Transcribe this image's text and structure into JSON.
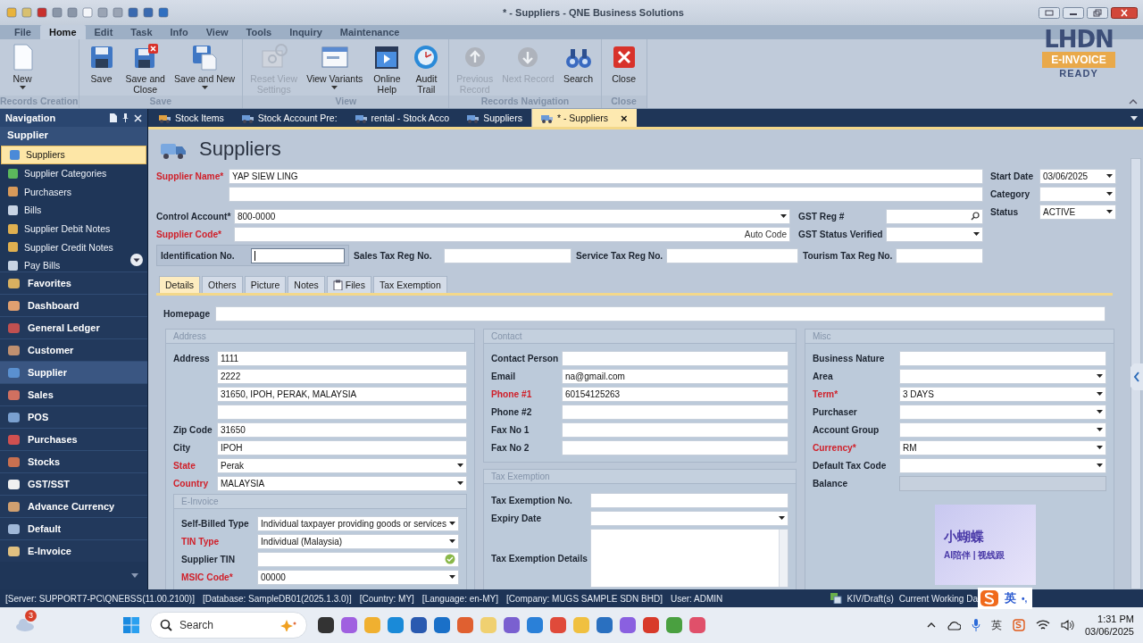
{
  "window": {
    "title": "* - Suppliers - QNE Business Solutions"
  },
  "ribbon": {
    "tabs": [
      {
        "label": "File",
        "selected": false
      },
      {
        "label": "Home",
        "selected": true
      },
      {
        "label": "Edit",
        "selected": false
      },
      {
        "label": "Task",
        "selected": false
      },
      {
        "label": "Info",
        "selected": false
      },
      {
        "label": "View",
        "selected": false
      },
      {
        "label": "Tools",
        "selected": false
      },
      {
        "label": "Inquiry",
        "selected": false
      },
      {
        "label": "Maintenance",
        "selected": false
      }
    ],
    "groups": [
      {
        "label": "Records Creation",
        "buttons": [
          {
            "label": "New",
            "dropdown": true,
            "disabled": false
          }
        ]
      },
      {
        "label": "Save",
        "buttons": [
          {
            "label": "Save",
            "dropdown": false,
            "disabled": false
          },
          {
            "label": "Save and\nClose",
            "dropdown": false,
            "disabled": false
          },
          {
            "label": "Save and New",
            "dropdown": true,
            "disabled": false
          }
        ]
      },
      {
        "label": "View",
        "buttons": [
          {
            "label": "Reset View\nSettings",
            "dropdown": false,
            "disabled": true
          },
          {
            "label": "View Variants",
            "dropdown": true,
            "disabled": false
          },
          {
            "label": "Online\nHelp",
            "dropdown": false,
            "disabled": false
          },
          {
            "label": "Audit\nTrail",
            "dropdown": false,
            "disabled": false
          }
        ]
      },
      {
        "label": "Records Navigation",
        "buttons": [
          {
            "label": "Previous\nRecord",
            "dropdown": false,
            "disabled": true
          },
          {
            "label": "Next Record",
            "dropdown": false,
            "disabled": true
          },
          {
            "label": "Search",
            "dropdown": false,
            "disabled": false
          }
        ]
      },
      {
        "label": "Close",
        "buttons": [
          {
            "label": "Close",
            "dropdown": false,
            "disabled": false
          }
        ]
      }
    ],
    "badge": {
      "title": "LHDN",
      "banner": "E-INVOICE",
      "subtitle": "READY"
    }
  },
  "navigation": {
    "title": "Navigation",
    "section": "Supplier",
    "items": [
      {
        "label": "Suppliers",
        "selected": true
      },
      {
        "label": "Supplier Categories",
        "selected": false
      },
      {
        "label": "Purchasers",
        "selected": false
      },
      {
        "label": "Bills",
        "selected": false
      },
      {
        "label": "Supplier Debit Notes",
        "selected": false
      },
      {
        "label": "Supplier Credit Notes",
        "selected": false
      },
      {
        "label": "Pay Bills",
        "selected": false
      }
    ],
    "modules": [
      {
        "label": "Favorites",
        "selected": false
      },
      {
        "label": "Dashboard",
        "selected": false
      },
      {
        "label": "General Ledger",
        "selected": false
      },
      {
        "label": "Customer",
        "selected": false
      },
      {
        "label": "Supplier",
        "selected": true
      },
      {
        "label": "Sales",
        "selected": false
      },
      {
        "label": "POS",
        "selected": false
      },
      {
        "label": "Purchases",
        "selected": false
      },
      {
        "label": "Stocks",
        "selected": false
      },
      {
        "label": "GST/SST",
        "selected": false
      },
      {
        "label": "Advance Currency",
        "selected": false
      },
      {
        "label": "Default",
        "selected": false
      },
      {
        "label": "E-Invoice",
        "selected": false
      }
    ]
  },
  "doc_tabs": [
    {
      "label": "Stock Items",
      "selected": false
    },
    {
      "label": "Stock Account Pre:",
      "selected": false
    },
    {
      "label": "rental - Stock Acco",
      "selected": false
    },
    {
      "label": "Suppliers",
      "selected": false
    },
    {
      "label": "* - Suppliers",
      "selected": true,
      "close": "×"
    }
  ],
  "page_title": "Suppliers",
  "header": {
    "supplier_name": {
      "label": "Supplier Name*",
      "required": true,
      "kind": "text",
      "value": "YAP SIEW LING"
    },
    "supplier_name_2": {
      "kind": "text"
    },
    "control_account": {
      "label": "Control Account*",
      "required": false,
      "kind": "combo",
      "value": "800-0000"
    },
    "supplier_code": {
      "label": "Supplier Code*",
      "required": true,
      "kind": "text",
      "suffix": "Auto Code"
    },
    "gst_reg": {
      "label": "GST Reg #",
      "required": false,
      "kind": "search"
    },
    "gst_status": {
      "label": "GST Status Verified",
      "required": false,
      "kind": "combo"
    },
    "identification": {
      "label": "Identification No.",
      "required": false,
      "kind": "text",
      "focused": true
    },
    "sales_tax": {
      "label": "Sales Tax Reg No.",
      "required": false,
      "kind": "text"
    },
    "service_tax": {
      "label": "Service Tax Reg No.",
      "required": false,
      "kind": "text"
    },
    "tourism_tax": {
      "label": "Tourism Tax Reg No.",
      "required": false,
      "kind": "text"
    },
    "start_date": {
      "label": "Start Date",
      "required": false,
      "kind": "combo",
      "value": "03/06/2025"
    },
    "category": {
      "label": "Category",
      "required": false,
      "kind": "combo"
    },
    "status": {
      "label": "Status",
      "required": false,
      "kind": "combo",
      "value": "ACTIVE"
    }
  },
  "detail_tabs": [
    {
      "label": "Details",
      "selected": true
    },
    {
      "label": "Others",
      "selected": false
    },
    {
      "label": "Picture",
      "selected": false
    },
    {
      "label": "Notes",
      "selected": false
    },
    {
      "label": "Files",
      "selected": false,
      "attachment": true
    },
    {
      "label": "Tax Exemption",
      "selected": false
    }
  ],
  "homepage": {
    "label": "Homepage",
    "required": false,
    "kind": "text"
  },
  "address": {
    "title": "Address",
    "fields": [
      {
        "label": "Address",
        "required": false,
        "kind": "text",
        "value": "1111"
      },
      {
        "kind": "text",
        "value": "2222"
      },
      {
        "kind": "text",
        "value": "31650, IPOH, PERAK, MALAYSIA"
      },
      {
        "kind": "text"
      },
      {
        "label": "Zip Code",
        "required": false,
        "kind": "text",
        "value": "31650"
      },
      {
        "label": "City",
        "required": false,
        "kind": "text",
        "value": "IPOH"
      },
      {
        "label": "State",
        "required": true,
        "kind": "combo",
        "value": "Perak"
      },
      {
        "label": "Country",
        "required": true,
        "kind": "combo",
        "value": "MALAYSIA"
      }
    ],
    "einvoice": {
      "title": "E-Invoice",
      "fields": [
        {
          "label": "Self-Billed Type",
          "required": false,
          "kind": "combo",
          "value": "Individual taxpayer providing goods or services"
        },
        {
          "label": "TIN Type",
          "required": true,
          "kind": "combo",
          "value": "Individual (Malaysia)"
        },
        {
          "label": "Supplier TIN",
          "required": false,
          "kind": "check"
        },
        {
          "label": "MSIC Code*",
          "required": true,
          "kind": "combo",
          "value": "00000"
        }
      ]
    }
  },
  "contact": {
    "title": "Contact",
    "fields": [
      {
        "label": "Contact Person",
        "required": false,
        "kind": "text"
      },
      {
        "label": "Email",
        "required": false,
        "kind": "text",
        "value": "na@gmail.com"
      },
      {
        "label": "Phone #1",
        "required": true,
        "kind": "text",
        "value": "60154125263"
      },
      {
        "label": "Phone #2",
        "required": false,
        "kind": "text"
      },
      {
        "label": "Fax No 1",
        "required": false,
        "kind": "text"
      },
      {
        "label": "Fax No 2",
        "required": false,
        "kind": "text"
      }
    ]
  },
  "tax_exemption": {
    "title": "Tax Exemption",
    "fields": [
      {
        "label": "Tax Exemption No.",
        "required": false,
        "kind": "text"
      },
      {
        "label": "Expiry Date",
        "required": false,
        "kind": "combo"
      },
      {
        "label": "Tax Exemption Details",
        "required": false,
        "kind": "area"
      }
    ]
  },
  "misc": {
    "title": "Misc",
    "fields": [
      {
        "label": "Business Nature",
        "required": false,
        "kind": "text"
      },
      {
        "label": "Area",
        "required": false,
        "kind": "combo"
      },
      {
        "label": "Term*",
        "required": true,
        "kind": "combo",
        "value": "3 DAYS"
      },
      {
        "label": "Purchaser",
        "required": false,
        "kind": "combo"
      },
      {
        "label": "Account Group",
        "required": false,
        "kind": "combo"
      },
      {
        "label": "Currency*",
        "required": true,
        "kind": "combo",
        "value": "RM"
      },
      {
        "label": "Default Tax Code",
        "required": false,
        "kind": "combo"
      },
      {
        "label": "Balance",
        "required": false,
        "kind": "disabled"
      }
    ]
  },
  "widget": {
    "title": "小蝴蝶",
    "subtitle": "AI陪伴 | 视线跟"
  },
  "status_bar": {
    "items": [
      "[Server: SUPPORT7-PC\\QNEBSS(11.00.2100)]",
      "[Database: SampleDB01(2025.1.3.0)]",
      "[Country: MY]",
      "[Language: en-MY]",
      "[Company: MUGS SAMPLE SDN BHD]",
      "User: ADMIN"
    ],
    "drafts": "KIV/Draft(s)",
    "working_date": "Current Working Da"
  },
  "ime_bar": {
    "mode": "英",
    "punct": "•,"
  },
  "taskbar": {
    "weather_badge": "3",
    "search": "Search",
    "tray_ime": "英",
    "time": "1:31 PM",
    "date": "03/06/2025"
  }
}
